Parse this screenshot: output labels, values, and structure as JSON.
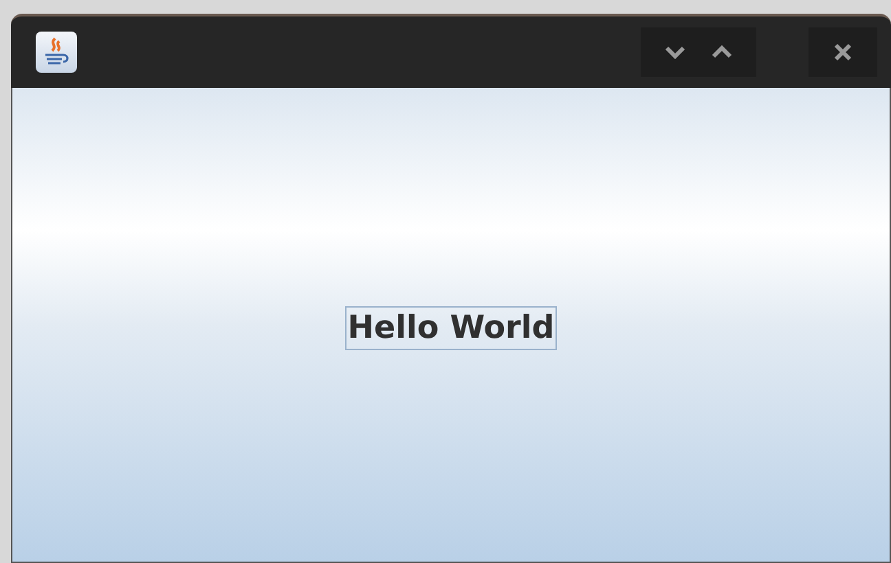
{
  "window": {
    "content": {
      "label": "Hello World"
    }
  }
}
